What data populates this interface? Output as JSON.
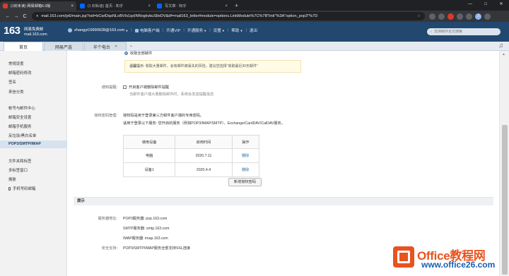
{
  "browser": {
    "tabs": [
      {
        "title": "(1封未读) 网易邮箱6.0版",
        "active": true,
        "favicon_color": "#d93a2f"
      },
      {
        "title": "(1 封私信) 首页 - 知乎",
        "active": false,
        "favicon_color": "#0066ff"
      },
      {
        "title": "写文章 - 知乎",
        "active": false,
        "favicon_color": "#0066ff"
      }
    ],
    "tab_close": "×",
    "new_tab": "+",
    "window_controls": [
      "—",
      "□",
      "✕"
    ],
    "nav": {
      "back": "←",
      "forward": "→",
      "reload": "C"
    },
    "url": "mail.163.com/js6/main.jsp?sid=bCwtDqsNLoBVIs1qxINNvgkvbuSlleDV&df=mail163_letter#module=options.LinkModule%7C%7B\"link\"%3A\"option_pop3\"%7D",
    "ext_avatar": "J"
  },
  "mail_header": {
    "logo": "163",
    "logo_sub1": "网易免费邮",
    "logo_sub2": "mail.163.com",
    "user": "zhangyi19990628@163.com",
    "links": [
      "电脑客户端",
      "开通VIP",
      "开通服务",
      "设置",
      "帮助",
      "退出"
    ],
    "search_placeholder": "支持邮件全文搜索"
  },
  "module_tabs": [
    {
      "label": "首页"
    },
    {
      "label": "网易严选"
    },
    {
      "label": "半个电台"
    }
  ],
  "module_more": "⌄",
  "sidebar": {
    "items": [
      {
        "label": "常规设置",
        "active": false
      },
      {
        "label": "邮箱密码修改",
        "active": false
      },
      {
        "label": "签名",
        "active": false
      },
      {
        "label": "来信分类",
        "active": false
      },
      {
        "label": "帐号与邮件中心",
        "active": false
      },
      {
        "label": "邮箱安全设置",
        "active": false
      },
      {
        "label": "邮箱手机服务",
        "active": false
      },
      {
        "label": "反垃圾/黑白名单",
        "active": false
      },
      {
        "label": "POP3/SMTP/IMAP",
        "active": true
      },
      {
        "label": "文件夹和标签",
        "active": false
      },
      {
        "label": "多标签窗口",
        "active": false
      },
      {
        "label": "换肤",
        "active": false
      },
      {
        "label": "手机号码邮箱",
        "active": false
      }
    ]
  },
  "content": {
    "radio_label": "收取全部邮件",
    "tip_label": "温馨提示:",
    "tip_text": "收取大量邮件，会有邮件被丢失的风险，建议您选择“收取最近30天邮件”",
    "notify_label": "通知提醒:",
    "notify_check": "开启客户端删除邮件提醒",
    "notify_sub": "当邮件客户端大量删除邮件时，系统会发送提醒信息",
    "auth_label": "授权密码管理:",
    "auth_line1": "授权码是用于登录第三方邮件客户端的专用密码。",
    "auth_line2": "适用于登录以下服务: 您开启的服务（例如POP3/IMAP/SMTP）、Exchange/CardDAV/CalDAV服务。",
    "table": {
      "headers": [
        "使用设备",
        "启用时间",
        "操作"
      ],
      "rows": [
        [
          "电脑",
          "2020.7.11",
          "删除"
        ],
        [
          "设备1",
          "2020.4.4",
          "删除"
        ]
      ]
    },
    "new_auth_button": "新增授权密码",
    "section_title": "提示",
    "server_label": "服务器地址:",
    "servers": [
      "POP3服务器: pop.163.com",
      "SMTP服务器: smtp.163.com",
      "IMAP服务器: imap.163.com"
    ],
    "security_label": "安全支持:",
    "security_text": "POP3/SMTP/IMAP服务全部支持SSL连接"
  },
  "watermark": {
    "line1": "Office教程网",
    "line2": "www.office26.com"
  }
}
